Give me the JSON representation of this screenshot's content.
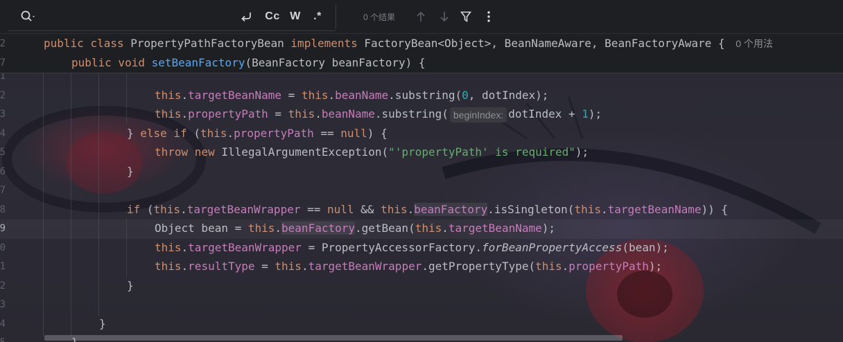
{
  "search": {
    "replace_icon": "wrap-arrow-icon",
    "match_case": "Cc",
    "words": "W",
    "regex": ".*",
    "result_count": "0 个结果"
  },
  "sticky": {
    "line1": {
      "num": "2",
      "kw1": "public class ",
      "classname": "PropertyPathFactoryBean ",
      "kw2": "implements ",
      "rest": "FactoryBean<Object>, BeanNameAware, BeanFactoryAware { ",
      "usages": "0 个用法"
    },
    "line2": {
      "num": "7",
      "kw": "public void ",
      "method": "setBeanFactory",
      "rest": "(BeanFactory beanFactory) {"
    }
  },
  "code": [
    {
      "num": "1",
      "segments": []
    },
    {
      "num": "2",
      "segments": [
        {
          "c": "kw",
          "t": "this"
        },
        {
          "c": "txt",
          "t": "."
        },
        {
          "c": "fld",
          "t": "targetBeanName"
        },
        {
          "c": "txt",
          "t": " = "
        },
        {
          "c": "kw",
          "t": "this"
        },
        {
          "c": "txt",
          "t": "."
        },
        {
          "c": "fld",
          "t": "beanName"
        },
        {
          "c": "txt",
          "t": ".substring("
        },
        {
          "c": "num",
          "t": "0"
        },
        {
          "c": "txt",
          "t": ", dotIndex);"
        }
      ]
    },
    {
      "num": "3",
      "segments": [
        {
          "c": "kw",
          "t": "this"
        },
        {
          "c": "txt",
          "t": "."
        },
        {
          "c": "fld",
          "t": "propertyPath"
        },
        {
          "c": "txt",
          "t": " = "
        },
        {
          "c": "kw",
          "t": "this"
        },
        {
          "c": "txt",
          "t": "."
        },
        {
          "c": "fld",
          "t": "beanName"
        },
        {
          "c": "txt",
          "t": ".substring("
        },
        {
          "c": "hint",
          "t": "beginIndex:"
        },
        {
          "c": "txt",
          "t": "dotIndex + "
        },
        {
          "c": "num",
          "t": "1"
        },
        {
          "c": "txt",
          "t": ");"
        }
      ]
    },
    {
      "num": "4",
      "segments": [
        {
          "c": "txt",
          "t": "} "
        },
        {
          "c": "kw",
          "t": "else if"
        },
        {
          "c": "txt",
          "t": " ("
        },
        {
          "c": "kw",
          "t": "this"
        },
        {
          "c": "txt",
          "t": "."
        },
        {
          "c": "fld",
          "t": "propertyPath"
        },
        {
          "c": "txt",
          "t": " == "
        },
        {
          "c": "kw",
          "t": "null"
        },
        {
          "c": "txt",
          "t": ") {"
        }
      ]
    },
    {
      "num": "5",
      "segments": [
        {
          "c": "kw",
          "t": "throw new "
        },
        {
          "c": "txt",
          "t": "IllegalArgumentException("
        },
        {
          "c": "str",
          "t": "\"'propertyPath' is required\""
        },
        {
          "c": "txt",
          "t": ");"
        }
      ]
    },
    {
      "num": "6",
      "segments": [
        {
          "c": "txt",
          "t": "}"
        }
      ]
    },
    {
      "num": "7",
      "segments": []
    },
    {
      "num": "8",
      "segments": [
        {
          "c": "kw",
          "t": "if"
        },
        {
          "c": "txt",
          "t": " ("
        },
        {
          "c": "kw",
          "t": "this"
        },
        {
          "c": "txt",
          "t": "."
        },
        {
          "c": "fld",
          "t": "targetBeanWrapper"
        },
        {
          "c": "txt",
          "t": " == "
        },
        {
          "c": "kw",
          "t": "null"
        },
        {
          "c": "txt",
          "t": " && "
        },
        {
          "c": "kw",
          "t": "this"
        },
        {
          "c": "txt",
          "t": "."
        },
        {
          "c": "fld hl",
          "t": "beanFactory"
        },
        {
          "c": "txt",
          "t": ".isSingleton("
        },
        {
          "c": "kw",
          "t": "this"
        },
        {
          "c": "txt",
          "t": "."
        },
        {
          "c": "fld",
          "t": "targetBeanName"
        },
        {
          "c": "txt",
          "t": ")) {"
        }
      ]
    },
    {
      "num": "9",
      "segments": [
        {
          "c": "txt",
          "t": "Object bean = "
        },
        {
          "c": "kw",
          "t": "this"
        },
        {
          "c": "txt",
          "t": "."
        },
        {
          "c": "fld hl",
          "t": "beanFactory"
        },
        {
          "c": "txt",
          "t": ".getBean("
        },
        {
          "c": "kw",
          "t": "this"
        },
        {
          "c": "txt",
          "t": "."
        },
        {
          "c": "fld",
          "t": "targetBeanName"
        },
        {
          "c": "txt",
          "t": ");"
        }
      ]
    },
    {
      "num": "0",
      "segments": [
        {
          "c": "kw",
          "t": "this"
        },
        {
          "c": "txt",
          "t": "."
        },
        {
          "c": "fld",
          "t": "targetBeanWrapper"
        },
        {
          "c": "txt",
          "t": " = PropertyAccessorFactory."
        },
        {
          "c": "txt ital",
          "t": "forBeanPropertyAccess"
        },
        {
          "c": "txt",
          "t": "(bean);"
        }
      ]
    },
    {
      "num": "1",
      "segments": [
        {
          "c": "kw",
          "t": "this"
        },
        {
          "c": "txt",
          "t": "."
        },
        {
          "c": "fld",
          "t": "resultType"
        },
        {
          "c": "txt",
          "t": " = "
        },
        {
          "c": "kw",
          "t": "this"
        },
        {
          "c": "txt",
          "t": "."
        },
        {
          "c": "fld",
          "t": "targetBeanWrapper"
        },
        {
          "c": "txt",
          "t": ".getPropertyType("
        },
        {
          "c": "kw",
          "t": "this"
        },
        {
          "c": "txt",
          "t": "."
        },
        {
          "c": "fld",
          "t": "propertyPath"
        },
        {
          "c": "txt",
          "t": ");"
        }
      ]
    },
    {
      "num": "2",
      "segments": [
        {
          "c": "txt",
          "t": "}"
        }
      ]
    },
    {
      "num": "3",
      "segments": []
    },
    {
      "num": "4",
      "segments": [
        {
          "c": "txt",
          "t": "}"
        }
      ]
    },
    {
      "num": "5",
      "segments": [
        {
          "c": "txt",
          "t": "}"
        }
      ]
    }
  ]
}
